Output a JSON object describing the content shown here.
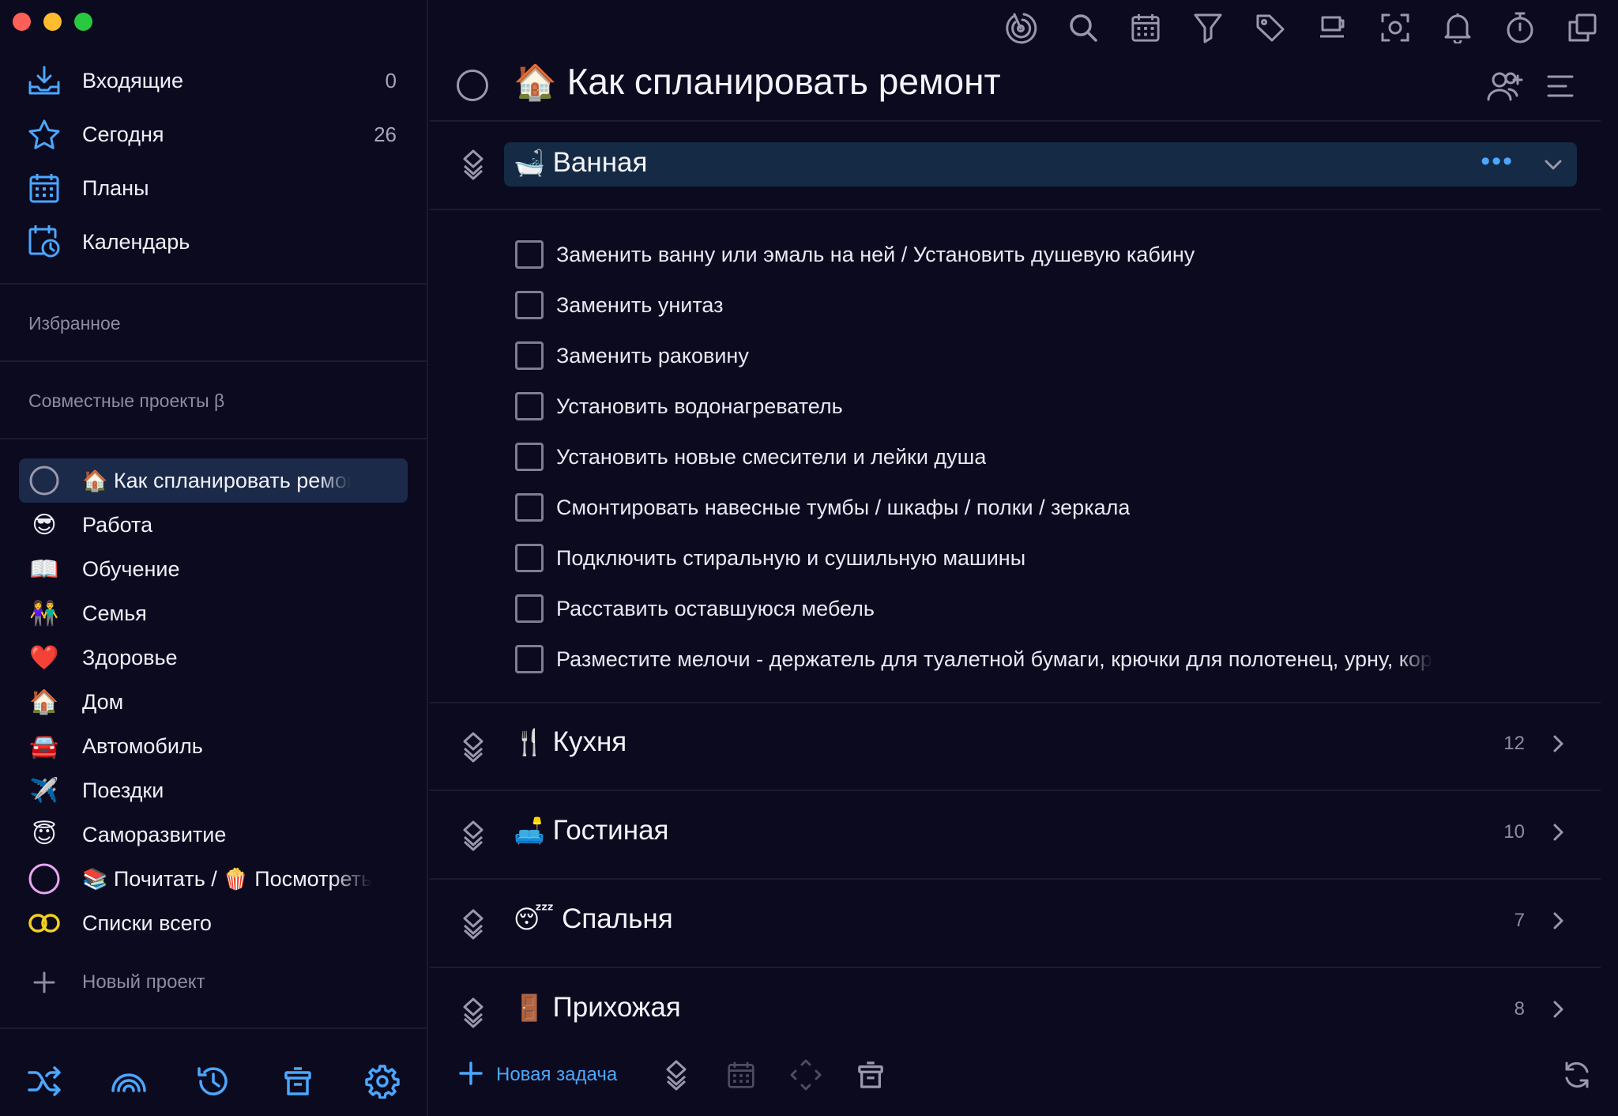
{
  "colors": {
    "accent": "#4ba7ff",
    "background": "#0c0a1f",
    "selected": "#1a2a48"
  },
  "sidebar": {
    "nav": [
      {
        "icon": "inbox-icon",
        "label": "Входящие",
        "count": "0"
      },
      {
        "icon": "star-icon",
        "label": "Сегодня",
        "count": "26"
      },
      {
        "icon": "calendar-grid-icon",
        "label": "Планы"
      },
      {
        "icon": "calendar-clock-icon",
        "label": "Календарь"
      }
    ],
    "favorites_label": "Избранное",
    "shared_label": "Совместные проекты β",
    "projects": [
      {
        "icon": "circle-icon",
        "emoji": "🏠",
        "label": "Как спланировать ремонт",
        "active": true
      },
      {
        "icon": "sunglasses-emoji",
        "emoji": "😎",
        "label": "Работа"
      },
      {
        "icon": "book-emoji",
        "emoji": "📖",
        "label": "Обучение"
      },
      {
        "icon": "family-emoji",
        "emoji": "👫",
        "label": "Семья"
      },
      {
        "icon": "heart-emoji",
        "emoji": "❤️",
        "label": "Здоровье"
      },
      {
        "icon": "house-emoji",
        "emoji": "🏠",
        "label": "Дом"
      },
      {
        "icon": "car-emoji",
        "emoji": "🚘",
        "label": "Автомобиль"
      },
      {
        "icon": "airplane-emoji",
        "emoji": "✈️",
        "label": "Поездки"
      },
      {
        "icon": "angel-emoji",
        "emoji": "😇",
        "label": "Саморазвитие"
      },
      {
        "icon": "circle-pink-icon",
        "label_parts": [
          "📚",
          "Почитать / ",
          "🍿",
          "Посмотреть"
        ]
      },
      {
        "icon": "infinity-icon",
        "label": "Списки всего"
      }
    ],
    "new_project_label": "Новый проект",
    "bottom_icons": [
      "shuffle-icon",
      "rainbow-icon",
      "history-icon",
      "trash-icon",
      "settings-gear-icon"
    ]
  },
  "toolbar": {
    "icons": [
      "focus-target-icon",
      "search-icon",
      "calendar-icon",
      "filter-icon",
      "tag-icon",
      "coffee-icon",
      "screenshot-icon",
      "bell-icon",
      "timer-icon",
      "copy-windows-icon"
    ]
  },
  "project": {
    "emoji": "🏠",
    "title": "Как спланировать ремонт"
  },
  "sections": [
    {
      "emoji": "🛁",
      "name": "Ванная",
      "expanded": true
    },
    {
      "emoji": "🍴",
      "name": "Кухня",
      "count": "12"
    },
    {
      "emoji": "🛋️",
      "name": "Гостиная",
      "count": "10"
    },
    {
      "emoji": "😴",
      "name": "Спальня",
      "count": "7"
    },
    {
      "emoji": "🚪",
      "name": "Прихожая",
      "count": "8"
    }
  ],
  "tasks": [
    "Заменить ванну или эмаль на ней / Установить душевую кабину",
    "Заменить унитаз",
    "Заменить раковину",
    "Установить водонагреватель",
    "Установить новые смесители и лейки душа",
    "Смонтировать навесные тумбы / шкафы / полки / зеркала",
    "Подключить стиральную и сушильную машины",
    "Расставить оставшуюся мебель",
    "Разместите мелочи - держатель для туалетной бумаги, крючки для полотенец, урну, кор"
  ],
  "bottombar": {
    "new_task_label": "Новая задача"
  }
}
